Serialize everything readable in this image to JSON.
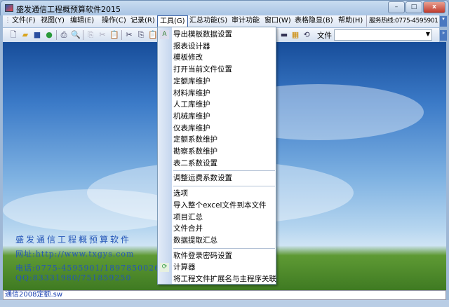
{
  "window": {
    "title": "盛发通信工程概预算软件2015",
    "minimize": "–",
    "maximize": "□",
    "close": "x"
  },
  "menubar": [
    "文件(F)",
    "视图(Y)",
    "编辑(E)",
    "操作(C)",
    "记录(R)",
    "工具(G)",
    "汇总功能(S)",
    "审计功能",
    "窗口(W)",
    "表格隐显(B)",
    "帮助(H)"
  ],
  "hotline": "服务热线:0775-4595901",
  "toolbar": {
    "file_label": "文件",
    "file_value": ""
  },
  "tools_menu": {
    "items": [
      "导出模板数据设置",
      "报表设计器",
      "模板修改",
      "打开当前文件位置",
      "定额库维护",
      "材料库维护",
      "人工库维护",
      "机械库维护",
      "仪表库维护",
      "定额系数维护",
      "勘察系数维护",
      "表二系数设置",
      "调整运费系数设置",
      "选项",
      "导入整个excel文件到本文件",
      "项目汇总",
      "文件合并",
      "数据提取汇总",
      "软件登录密码设置",
      "计算器",
      "将工程文件扩展名与主程序关联"
    ]
  },
  "banner": {
    "name": "盛发通信工程概预算软件",
    "website": "网址:http://www.txgys.com",
    "phone": "电话:0775-4595901/18978500269",
    "qq": "QQ:83331980/751859250"
  },
  "status": {
    "file": "通信2008定额.sw"
  }
}
